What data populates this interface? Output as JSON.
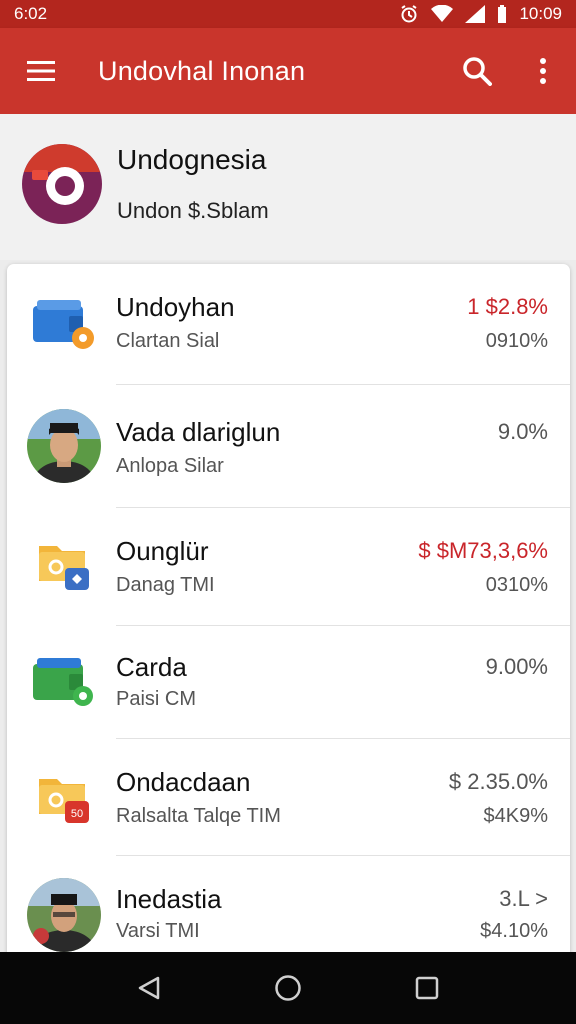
{
  "status_bar": {
    "time": "6:02",
    "clock": "10:09"
  },
  "app_bar": {
    "title": "Undovhal Inonan"
  },
  "profile": {
    "name": "Undognesia",
    "subtitle": "Undon $.Sblam"
  },
  "accounts": [
    {
      "title": "Undoyhan",
      "subtitle": "Clartan Sial",
      "amount": "1 $2.8%",
      "amount_red": true,
      "percent": "0910%",
      "icon": "wallet-icon",
      "color": "#2f7bd6"
    },
    {
      "title": "Vada dlariglun",
      "subtitle": "Anlopa Silar",
      "amount": "9.0%",
      "amount_red": false,
      "percent": "",
      "icon": "person-avatar",
      "color": "#3d8f3a"
    },
    {
      "title": "Ounglür",
      "subtitle": "Danag TMI",
      "amount": "$ $M73,3,6%",
      "amount_red": true,
      "percent": "0310%",
      "icon": "folder-icon",
      "color": "#f2b53a"
    },
    {
      "title": "Carda",
      "subtitle": "Paisi CM",
      "amount": "9.00%",
      "amount_red": false,
      "percent": "",
      "icon": "wallet-icon",
      "color": "#3aa44a"
    },
    {
      "title": "Ondacdaan",
      "subtitle": "Ralsalta Talqe TIM",
      "amount": "$ 2.35.0%",
      "amount_red": false,
      "percent": "$4K9%",
      "icon": "folder-icon",
      "color": "#f2b53a"
    },
    {
      "title": "Inedastia",
      "subtitle": "Varsi TMI",
      "amount": "3.L >",
      "amount_red": false,
      "percent": "$4.10%",
      "icon": "person-avatar",
      "color": "#3d8f3a"
    }
  ],
  "colors": {
    "primary": "#c9352c",
    "status": "#b3261e",
    "negative": "#c9252a"
  }
}
